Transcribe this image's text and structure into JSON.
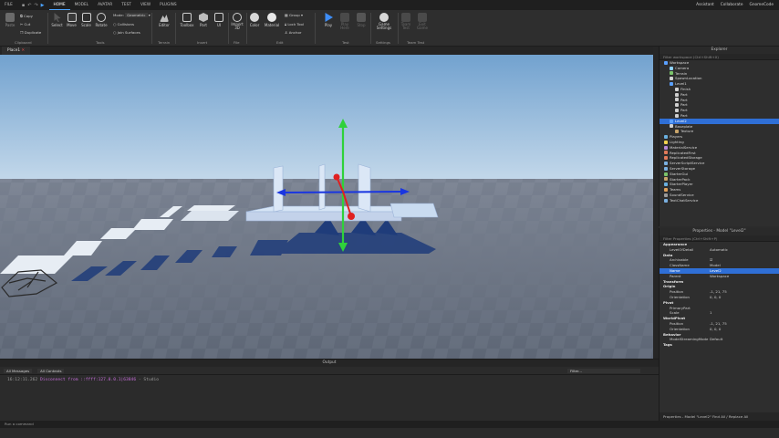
{
  "menu": {
    "file": "FILE",
    "tabs": [
      "HOME",
      "MODEL",
      "AVATAR",
      "TEST",
      "VIEW",
      "PLUGINS"
    ],
    "active_tab": "HOME",
    "assistant": "Assistant",
    "collaborate": "Collaborate",
    "user": "GnomeCode"
  },
  "ribbon": {
    "clipboard": {
      "paste": "Paste",
      "copy": "Copy",
      "cut": "Cut",
      "duplicate": "Duplicate",
      "label": "Clipboard"
    },
    "tools": {
      "select": "Select",
      "move": "Move",
      "scale": "Scale",
      "rotate": "Rotate",
      "mode_label": "Mode:",
      "mode_value": "Geometric",
      "collisions": "Collisions",
      "join_surfaces": "Join Surfaces",
      "label": "Tools"
    },
    "terrain": {
      "editor": "Editor",
      "label": "Terrain"
    },
    "insert": {
      "toolbox": "Toolbox",
      "part": "Part",
      "ui": "UI",
      "label": "Insert"
    },
    "file": {
      "import3d": "Import 3D",
      "label": "File"
    },
    "edit": {
      "color": "Color",
      "material": "Material",
      "group": "Group",
      "lock_tool": "Lock Tool",
      "anchor": "Anchor",
      "label": "Edit"
    },
    "test": {
      "play": "Play",
      "play_here": "Play Here",
      "stop": "Stop",
      "label": "Test"
    },
    "settings": {
      "game_settings": "Game Settings",
      "label": "Settings"
    },
    "team_test": {
      "team_test": "Team Test",
      "exit_game": "Exit Game",
      "label": "Team Test"
    }
  },
  "document_tab": "Place1",
  "explorer": {
    "title": "Explorer",
    "filter_placeholder": "Filter workspace (Ctrl+Shift+X)",
    "items": [
      {
        "label": "Workspace",
        "depth": 0,
        "color": "#5aa0ff",
        "selected": false
      },
      {
        "label": "Camera",
        "depth": 1,
        "color": "#8fd3ff",
        "selected": false
      },
      {
        "label": "Terrain",
        "depth": 1,
        "color": "#7ac36a",
        "selected": false
      },
      {
        "label": "SpawnLocation",
        "depth": 1,
        "color": "#cfcfcf",
        "selected": false
      },
      {
        "label": "Level1",
        "depth": 1,
        "color": "#5aa0ff",
        "selected": false
      },
      {
        "label": "Finish",
        "depth": 2,
        "color": "#cfcfcf",
        "selected": false
      },
      {
        "label": "Part",
        "depth": 2,
        "color": "#cfcfcf",
        "selected": false
      },
      {
        "label": "Part",
        "depth": 2,
        "color": "#cfcfcf",
        "selected": false
      },
      {
        "label": "Part",
        "depth": 2,
        "color": "#cfcfcf",
        "selected": false
      },
      {
        "label": "Part",
        "depth": 2,
        "color": "#cfcfcf",
        "selected": false
      },
      {
        "label": "Part",
        "depth": 2,
        "color": "#cfcfcf",
        "selected": false
      },
      {
        "label": "Level2",
        "depth": 1,
        "color": "#5aa0ff",
        "selected": true
      },
      {
        "label": "Baseplate",
        "depth": 1,
        "color": "#cfcfcf",
        "selected": false
      },
      {
        "label": "Texture",
        "depth": 2,
        "color": "#c9a56a",
        "selected": false
      },
      {
        "label": "Players",
        "depth": 0,
        "color": "#6ab0e0",
        "selected": false
      },
      {
        "label": "Lighting",
        "depth": 0,
        "color": "#f2d34f",
        "selected": false
      },
      {
        "label": "MaterialService",
        "depth": 0,
        "color": "#b58ad8",
        "selected": false
      },
      {
        "label": "ReplicatedFirst",
        "depth": 0,
        "color": "#e07a5a",
        "selected": false
      },
      {
        "label": "ReplicatedStorage",
        "depth": 0,
        "color": "#e07a5a",
        "selected": false
      },
      {
        "label": "ServerScriptService",
        "depth": 0,
        "color": "#7ab0e0",
        "selected": false
      },
      {
        "label": "ServerStorage",
        "depth": 0,
        "color": "#7ab0e0",
        "selected": false
      },
      {
        "label": "StarterGui",
        "depth": 0,
        "color": "#7ac36a",
        "selected": false
      },
      {
        "label": "StarterPack",
        "depth": 0,
        "color": "#c9a56a",
        "selected": false
      },
      {
        "label": "StarterPlayer",
        "depth": 0,
        "color": "#6ab0e0",
        "selected": false
      },
      {
        "label": "Teams",
        "depth": 0,
        "color": "#e0a05a",
        "selected": false
      },
      {
        "label": "SoundService",
        "depth": 0,
        "color": "#9a9a9a",
        "selected": false
      },
      {
        "label": "TextChatService",
        "depth": 0,
        "color": "#7ab0e0",
        "selected": false
      }
    ]
  },
  "properties": {
    "title": "Properties - Model \"Level2\"",
    "filter_placeholder": "Filter Properties (Ctrl+Shift+P)",
    "rows": [
      {
        "key": "Appearance",
        "value": "",
        "section": true
      },
      {
        "key": "LevelOfDetail",
        "value": "Automatic",
        "section": false
      },
      {
        "key": "Data",
        "value": "",
        "section": true
      },
      {
        "key": "Archivable",
        "value": "☑",
        "section": false
      },
      {
        "key": "ClassName",
        "value": "Model",
        "section": false
      },
      {
        "key": "Name",
        "value": "Level2",
        "section": false,
        "selected": true
      },
      {
        "key": "Parent",
        "value": "Workspace",
        "section": false
      },
      {
        "key": "Transform",
        "value": "",
        "section": true
      },
      {
        "key": "Origin",
        "value": "",
        "section": true
      },
      {
        "key": "Position",
        "value": "-1, 21, 75",
        "section": false
      },
      {
        "key": "Orientation",
        "value": "0, 0, 0",
        "section": false
      },
      {
        "key": "Pivot",
        "value": "",
        "section": true
      },
      {
        "key": "PrimaryPart",
        "value": "",
        "section": false
      },
      {
        "key": "Scale",
        "value": "1",
        "section": false
      },
      {
        "key": "WorldPivot",
        "value": "",
        "section": true
      },
      {
        "key": "Position",
        "value": "-1, 21, 75",
        "section": false
      },
      {
        "key": "Orientation",
        "value": "0, 0, 0",
        "section": false
      },
      {
        "key": "Behavior",
        "value": "",
        "section": true
      },
      {
        "key": "ModelStreamingMode",
        "value": "Default",
        "section": false
      },
      {
        "key": "Tags",
        "value": "",
        "section": true
      }
    ],
    "footer": "Properties - Model \"Level2\"    Find All / Replace All"
  },
  "output": {
    "title": "Output",
    "filter_all_messages": "All Messages",
    "filter_all_contexts": "All Contexts",
    "filter_placeholder": "Filter...",
    "line_time": "16:12:11.262",
    "line_msg": "Disconnect from ::ffff:127.0.0.1|63846",
    "line_ctx": "- Studio"
  },
  "command_placeholder": "Run a command",
  "colors": {
    "accent": "#2f6fd6",
    "gizmo_y": "#2fd13a",
    "gizmo_x": "#1a36e0",
    "gizmo_rotate": "#e02020",
    "output_error": "#c36bd6"
  }
}
